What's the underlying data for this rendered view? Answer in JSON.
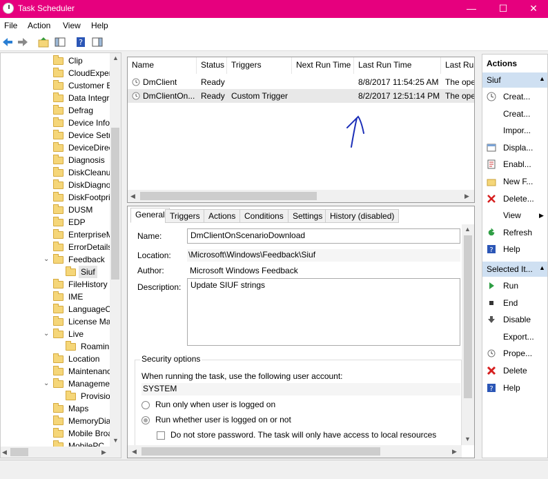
{
  "window": {
    "title": "Task Scheduler",
    "minimize": "—",
    "maximize": "☐",
    "close": "✕"
  },
  "menu": [
    "File",
    "Action",
    "View",
    "Help"
  ],
  "tree": {
    "items": [
      {
        "label": "Clip",
        "level": 0,
        "caret": ""
      },
      {
        "label": "CloudExper",
        "level": 0,
        "caret": ""
      },
      {
        "label": "Customer E",
        "level": 0,
        "caret": ""
      },
      {
        "label": "Data Integri",
        "level": 0,
        "caret": ""
      },
      {
        "label": "Defrag",
        "level": 0,
        "caret": ""
      },
      {
        "label": "Device Info",
        "level": 0,
        "caret": ""
      },
      {
        "label": "Device Setu",
        "level": 0,
        "caret": ""
      },
      {
        "label": "DeviceDirec",
        "level": 0,
        "caret": ""
      },
      {
        "label": "Diagnosis",
        "level": 0,
        "caret": ""
      },
      {
        "label": "DiskCleanu",
        "level": 0,
        "caret": ""
      },
      {
        "label": "DiskDiagno",
        "level": 0,
        "caret": ""
      },
      {
        "label": "DiskFootpri",
        "level": 0,
        "caret": ""
      },
      {
        "label": "DUSM",
        "level": 0,
        "caret": ""
      },
      {
        "label": "EDP",
        "level": 0,
        "caret": ""
      },
      {
        "label": "EnterpriseM",
        "level": 0,
        "caret": ""
      },
      {
        "label": "ErrorDetails",
        "level": 0,
        "caret": ""
      },
      {
        "label": "Feedback",
        "level": 0,
        "caret": "⌄"
      },
      {
        "label": "Siuf",
        "level": 1,
        "caret": "",
        "selected": true
      },
      {
        "label": "FileHistory",
        "level": 0,
        "caret": ""
      },
      {
        "label": "IME",
        "level": 0,
        "caret": ""
      },
      {
        "label": "LanguageC",
        "level": 0,
        "caret": ""
      },
      {
        "label": "License Ma",
        "level": 0,
        "caret": ""
      },
      {
        "label": "Live",
        "level": 0,
        "caret": "⌄"
      },
      {
        "label": "Roamin",
        "level": 1,
        "caret": ""
      },
      {
        "label": "Location",
        "level": 0,
        "caret": ""
      },
      {
        "label": "Maintenanc",
        "level": 0,
        "caret": ""
      },
      {
        "label": "Manageme",
        "level": 0,
        "caret": "⌄"
      },
      {
        "label": "Provisio",
        "level": 1,
        "caret": ""
      },
      {
        "label": "Maps",
        "level": 0,
        "caret": ""
      },
      {
        "label": "MemoryDia",
        "level": 0,
        "caret": ""
      },
      {
        "label": "Mobile Broa",
        "level": 0,
        "caret": ""
      },
      {
        "label": "MobilePC",
        "level": 0,
        "caret": ""
      }
    ]
  },
  "tasklist": {
    "columns": [
      "Name",
      "Status",
      "Triggers",
      "Next Run Time",
      "Last Run Time",
      "Last Ru"
    ],
    "rows": [
      {
        "name": "DmClient",
        "status": "Ready",
        "triggers": "",
        "next": "",
        "last": "8/8/2017 11:54:25 AM",
        "result": "The ope"
      },
      {
        "name": "DmClientOn...",
        "status": "Ready",
        "triggers": "Custom Trigger",
        "next": "",
        "last": "8/2/2017 12:51:14 PM",
        "result": "The ope"
      }
    ]
  },
  "details": {
    "tabs": [
      "General",
      "Triggers",
      "Actions",
      "Conditions",
      "Settings",
      "History (disabled)"
    ],
    "name_label": "Name:",
    "name_value": "DmClientOnScenarioDownload",
    "location_label": "Location:",
    "location_value": "\\Microsoft\\Windows\\Feedback\\Siuf",
    "author_label": "Author:",
    "author_value": "Microsoft Windows Feedback",
    "description_label": "Description:",
    "description_value": "Update SIUF strings",
    "security_title": "Security options",
    "account_prompt": "When running the task, use the following user account:",
    "account_value": "SYSTEM",
    "radio_logged_on": "Run only when user is logged on",
    "radio_whether": "Run whether user is logged on or not",
    "check_no_store": "Do not store password.  The task will only have access to local resources"
  },
  "actions": {
    "header": "Actions",
    "group1": "Siuf",
    "group1_items": [
      {
        "label": "Creat...",
        "icon": "create-basic-task-icon"
      },
      {
        "label": "Creat...",
        "icon": "create-task-icon"
      },
      {
        "label": "Impor...",
        "icon": "import-icon"
      },
      {
        "label": "Displa...",
        "icon": "display-running-icon"
      },
      {
        "label": "Enabl...",
        "icon": "enable-history-icon"
      },
      {
        "label": "New F...",
        "icon": "new-folder-icon"
      },
      {
        "label": "Delete...",
        "icon": "delete-folder-icon"
      },
      {
        "label": "View",
        "icon": ""
      },
      {
        "label": "Refresh",
        "icon": "refresh-icon"
      },
      {
        "label": "Help",
        "icon": "help-icon"
      }
    ],
    "group2": "Selected It...",
    "group2_items": [
      {
        "label": "Run",
        "icon": "run-icon"
      },
      {
        "label": "End",
        "icon": "end-icon"
      },
      {
        "label": "Disable",
        "icon": "disable-icon"
      },
      {
        "label": "Export...",
        "icon": ""
      },
      {
        "label": "Prope...",
        "icon": "properties-icon"
      },
      {
        "label": "Delete",
        "icon": "delete-icon"
      },
      {
        "label": "Help",
        "icon": "help-icon"
      }
    ]
  },
  "colors": {
    "titlebar": "#e6007e",
    "selection": "#cfe0f2",
    "annotation": "#1c2fb8"
  }
}
